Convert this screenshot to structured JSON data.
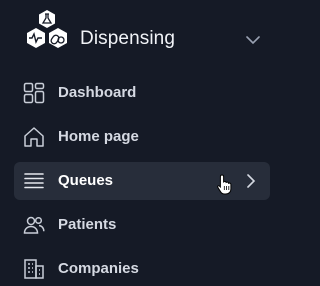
{
  "brand": {
    "title": "Dispensing",
    "logo_icon": "pharmacy-hexagon-logo",
    "collapse_icon": "chevron-down-icon"
  },
  "nav": {
    "items": [
      {
        "label": "Dashboard",
        "icon": "dashboard-grid-icon",
        "active": false
      },
      {
        "label": "Home page",
        "icon": "home-icon",
        "active": false
      },
      {
        "label": "Queues",
        "icon": "queue-list-icon",
        "active": true
      },
      {
        "label": "Patients",
        "icon": "users-icon",
        "active": false
      },
      {
        "label": "Companies",
        "icon": "building-icon",
        "active": false
      }
    ]
  },
  "colors": {
    "background": "#151a26",
    "active_background": "#272d3a",
    "text": "#d5d9e2",
    "icon": "#c9ced8"
  }
}
